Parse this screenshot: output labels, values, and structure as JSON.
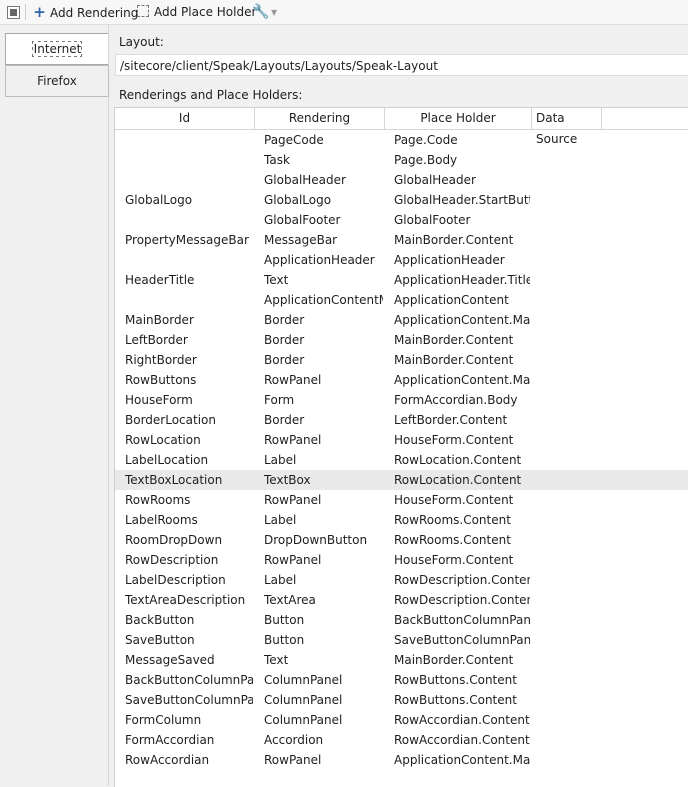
{
  "toolbar": {
    "add_rendering": "Add Rendering",
    "add_placeholder": "Add Place Holder"
  },
  "tabs": [
    {
      "label": "Internet Explorer",
      "selected": true
    },
    {
      "label": "Firefox",
      "selected": false
    }
  ],
  "layout": {
    "label": "Layout:",
    "value": "/sitecore/client/Speak/Layouts/Layouts/Speak-Layout"
  },
  "renderings": {
    "label": "Renderings and Place Holders:",
    "columns": [
      "Id",
      "Rendering",
      "Place Holder",
      "Data Source"
    ],
    "selected_index": 17,
    "rows": [
      {
        "id": "",
        "rendering": "PageCode",
        "placeholder": "Page.Code"
      },
      {
        "id": "",
        "rendering": "Task",
        "placeholder": "Page.Body"
      },
      {
        "id": "",
        "rendering": "GlobalHeader",
        "placeholder": "GlobalHeader"
      },
      {
        "id": "GlobalLogo",
        "rendering": "GlobalLogo",
        "placeholder": "GlobalHeader.StartButton"
      },
      {
        "id": "",
        "rendering": "GlobalFooter",
        "placeholder": "GlobalFooter"
      },
      {
        "id": "PropertyMessageBar",
        "rendering": "MessageBar",
        "placeholder": "MainBorder.Content"
      },
      {
        "id": "",
        "rendering": "ApplicationHeader",
        "placeholder": "ApplicationHeader"
      },
      {
        "id": "HeaderTitle",
        "rendering": "Text",
        "placeholder": "ApplicationHeader.Title"
      },
      {
        "id": "",
        "rendering": "ApplicationContentMI",
        "placeholder": "ApplicationContent"
      },
      {
        "id": "MainBorder",
        "rendering": "Border",
        "placeholder": "ApplicationContent.Main"
      },
      {
        "id": "LeftBorder",
        "rendering": "Border",
        "placeholder": "MainBorder.Content"
      },
      {
        "id": "RightBorder",
        "rendering": "Border",
        "placeholder": "MainBorder.Content"
      },
      {
        "id": "RowButtons",
        "rendering": "RowPanel",
        "placeholder": "ApplicationContent.Main"
      },
      {
        "id": "HouseForm",
        "rendering": "Form",
        "placeholder": "FormAccordian.Body"
      },
      {
        "id": "BorderLocation",
        "rendering": "Border",
        "placeholder": "LeftBorder.Content"
      },
      {
        "id": "RowLocation",
        "rendering": "RowPanel",
        "placeholder": "HouseForm.Content"
      },
      {
        "id": "LabelLocation",
        "rendering": "Label",
        "placeholder": "RowLocation.Content"
      },
      {
        "id": "TextBoxLocation",
        "rendering": "TextBox",
        "placeholder": "RowLocation.Content"
      },
      {
        "id": "RowRooms",
        "rendering": "RowPanel",
        "placeholder": "HouseForm.Content"
      },
      {
        "id": "LabelRooms",
        "rendering": "Label",
        "placeholder": "RowRooms.Content"
      },
      {
        "id": "RoomDropDown",
        "rendering": "DropDownButton",
        "placeholder": "RowRooms.Content"
      },
      {
        "id": "RowDescription",
        "rendering": "RowPanel",
        "placeholder": "HouseForm.Content"
      },
      {
        "id": "LabelDescription",
        "rendering": "Label",
        "placeholder": "RowDescription.Content"
      },
      {
        "id": "TextAreaDescription",
        "rendering": "TextArea",
        "placeholder": "RowDescription.Content"
      },
      {
        "id": "BackButton",
        "rendering": "Button",
        "placeholder": "BackButtonColumnPanel."
      },
      {
        "id": "SaveButton",
        "rendering": "Button",
        "placeholder": "SaveButtonColumnPanel."
      },
      {
        "id": "MessageSaved",
        "rendering": "Text",
        "placeholder": "MainBorder.Content"
      },
      {
        "id": "BackButtonColumnPane",
        "rendering": "ColumnPanel",
        "placeholder": "RowButtons.Content"
      },
      {
        "id": "SaveButtonColumnPane",
        "rendering": "ColumnPanel",
        "placeholder": "RowButtons.Content"
      },
      {
        "id": "FormColumn",
        "rendering": "ColumnPanel",
        "placeholder": "RowAccordian.Content"
      },
      {
        "id": "FormAccordian",
        "rendering": "Accordion",
        "placeholder": "RowAccordian.Content"
      },
      {
        "id": "RowAccordian",
        "rendering": "RowPanel",
        "placeholder": "ApplicationContent.Main"
      }
    ]
  }
}
